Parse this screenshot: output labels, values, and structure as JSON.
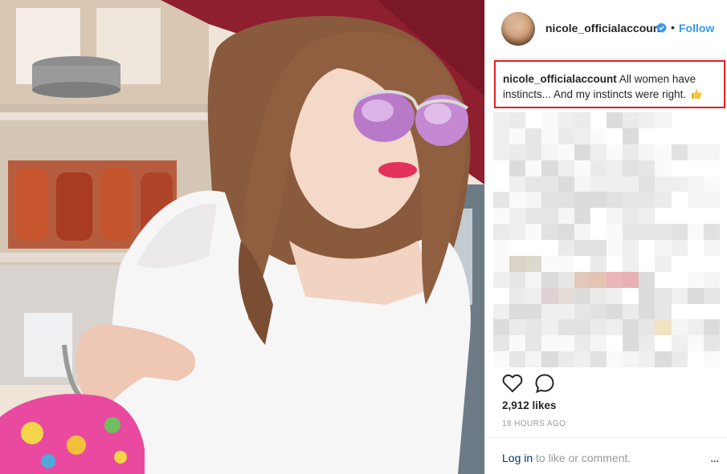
{
  "post": {
    "username": "nicole_officialaccount",
    "dot": "•",
    "follow_label": "Follow",
    "caption_username": "nicole_officialaccount",
    "caption_text": "All women have instincts... And my instincts were right.",
    "likes": "2,912 likes",
    "timestamp": "18 HOURS AGO",
    "login_label": "Log in",
    "login_suffix": "to like or comment.",
    "more_label": "..."
  },
  "icons": {
    "verified": "verified-badge-icon",
    "thumb": "thumbs-up-emoji-icon",
    "heart": "heart-icon",
    "comment": "comment-icon"
  },
  "colors": {
    "accent": "#3897f0",
    "highlight_box": "#e02020",
    "login_link": "#003569",
    "muted": "#999999"
  }
}
